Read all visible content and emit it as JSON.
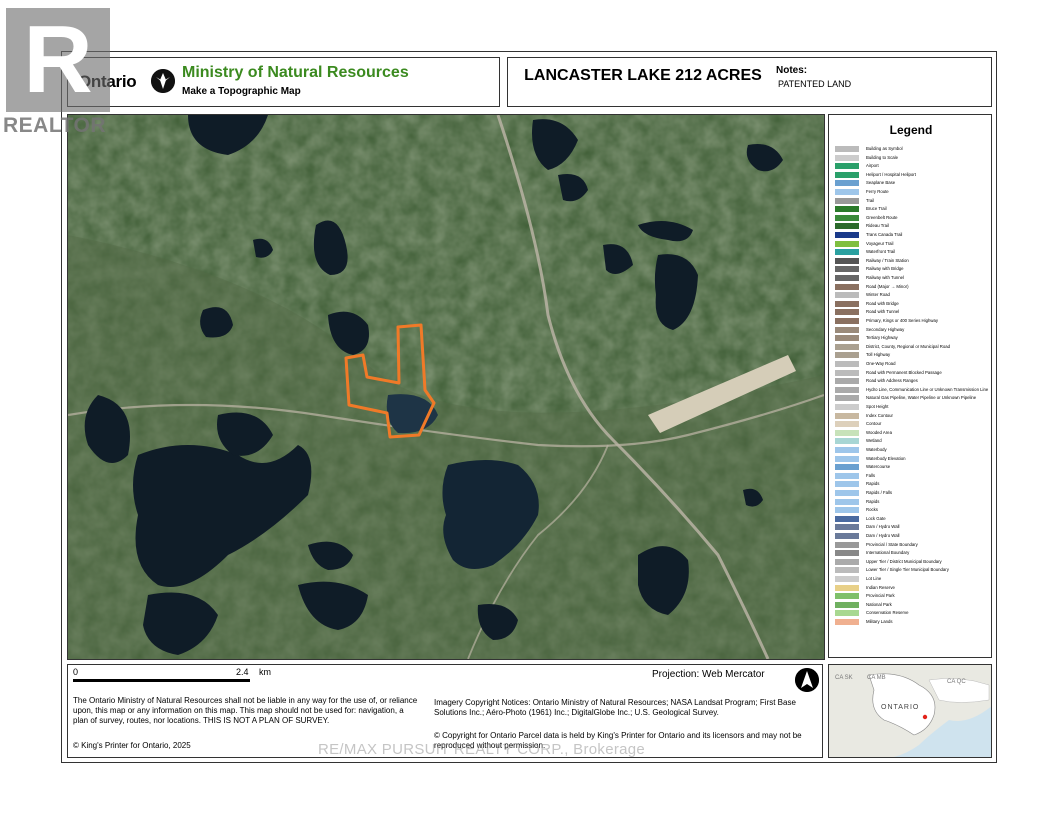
{
  "header": {
    "ontario_wordmark": "Ontario",
    "ministry": "Ministry of Natural Resources",
    "subtitle": "Make a Topographic Map",
    "map_title": "LANCASTER LAKE 212 ACRES",
    "notes_label": "Notes:",
    "notes_value": "PATENTED LAND"
  },
  "colors": {
    "ministry_green": "#3b8a1f",
    "parcel_outline": "#f07a28",
    "map_forest": "#3e5d35",
    "lake": "#0f1c27"
  },
  "map": {
    "parcel_name": "Lancaster Lake parcel",
    "icons": [
      "trillium-logo-icon",
      "north-arrow-icon"
    ]
  },
  "legend": {
    "title": "Legend",
    "items": [
      "Building as Symbol",
      "Building to Scale",
      "Airport",
      "Heliport / Hospital Heliport",
      "Seaplane Base",
      "Ferry Route",
      "Trail",
      "Bruce Trail",
      "Greenbelt Route",
      "Rideau Trail",
      "Trans Canada Trail",
      "Voyageur Trail",
      "Waterfront Trail",
      "Railway / Train Station",
      "Railway with Bridge",
      "Railway with Tunnel",
      "Road (Major → Minor)",
      "Winter Road",
      "Road with Bridge",
      "Road with Tunnel",
      "Primary, Kings or 400 Series Highway",
      "Secondary Highway",
      "Tertiary Highway",
      "District, County, Regional or Municipal Road",
      "Toll Highway",
      "One-Way Road",
      "Road with Permanent Blocked Passage",
      "Road with Address Ranges",
      "Hydro Line, Communication Line or Unknown Transmission Line",
      "Natural Gas Pipeline, Water Pipeline or Unknown Pipeline",
      "Spot Height",
      "Index Contour",
      "Contour",
      "Wooded Area",
      "Wetland",
      "Waterbody",
      "Waterbody Elevation",
      "Watercourse",
      "Falls",
      "Rapids",
      "Rapids / Falls",
      "Rapids",
      "Rocks",
      "Lock Gate",
      "Dam / Hydro Wall",
      "Dam / Hydro Wall",
      "Provincial / State Boundary",
      "International Boundary",
      "Upper Tier / District Municipal Boundary",
      "Lower Tier / Single Tier Municipal Boundary",
      "Lot Line",
      "Indian Reserve",
      "Provincial Park",
      "National Park",
      "Conservation Reserve",
      "Military Lands"
    ],
    "swatches": [
      "#bbbbbb",
      "#cccccc",
      "#2aa06a",
      "#2aa06a",
      "#6aa0d0",
      "#9ec6ea",
      "#999999",
      "#2b7a2b",
      "#3a8a3a",
      "#2b6a2b",
      "#1a3a8a",
      "#7fbf3f",
      "#2aa0a0",
      "#555555",
      "#666666",
      "#666666",
      "#8a7060",
      "#bbbbbb",
      "#8a7060",
      "#8a7060",
      "#8a7060",
      "#9a8a7a",
      "#9a8a7a",
      "#aaa090",
      "#aaa090",
      "#bbbbbb",
      "#bbbbbb",
      "#aaaaaa",
      "#aaaaaa",
      "#aaaaaa",
      "#cccccc",
      "#c8b8a0",
      "#ddd0bb",
      "#c7e2b9",
      "#a8d6d4",
      "#9ec6ea",
      "#9ec6ea",
      "#6aa0d0",
      "#9ec6ea",
      "#9ec6ea",
      "#9ec6ea",
      "#9ec6ea",
      "#9ec6ea",
      "#4a6aa0",
      "#6a7a9a",
      "#6a7a9a",
      "#999999",
      "#888888",
      "#aaaaaa",
      "#bbbbbb",
      "#cccccc",
      "#e8d088",
      "#7fc06a",
      "#70b060",
      "#a8d890",
      "#f0b090"
    ]
  },
  "footer": {
    "scale_zero": "0",
    "scale_value": "2.4",
    "scale_unit": "km",
    "projection": "Projection: Web Mercator",
    "disclaimer": "The Ontario Ministry of Natural Resources shall not be liable in any way for the use of, or reliance upon, this map or any information on this map. This map should not be used for: navigation, a plan of survey, routes, nor locations. THIS IS NOT A PLAN OF SURVEY.",
    "copyright": "© King's Printer for Ontario, 2025",
    "imagery": "Imagery Copyright Notices: Ontario Ministry of Natural Resources; NASA Landsat Program; First Base Solutions Inc.; Aéro-Photo (1961) Inc.; DigitalGlobe Inc.; U.S. Geological Survey.",
    "parcel_copyright": "© Copyright for Ontario Parcel data is held by King's Printer for Ontario and its licensors and may not be reproduced without permission."
  },
  "inset": {
    "labels": [
      "CA SK",
      "CA MB",
      "CA QC",
      "ONTARIO"
    ]
  },
  "watermarks": {
    "realtor": "REALTOR",
    "realtor_letter": "R",
    "brokerage": "RE/MAX PURSUIT REALTY CORP., Brokerage"
  }
}
